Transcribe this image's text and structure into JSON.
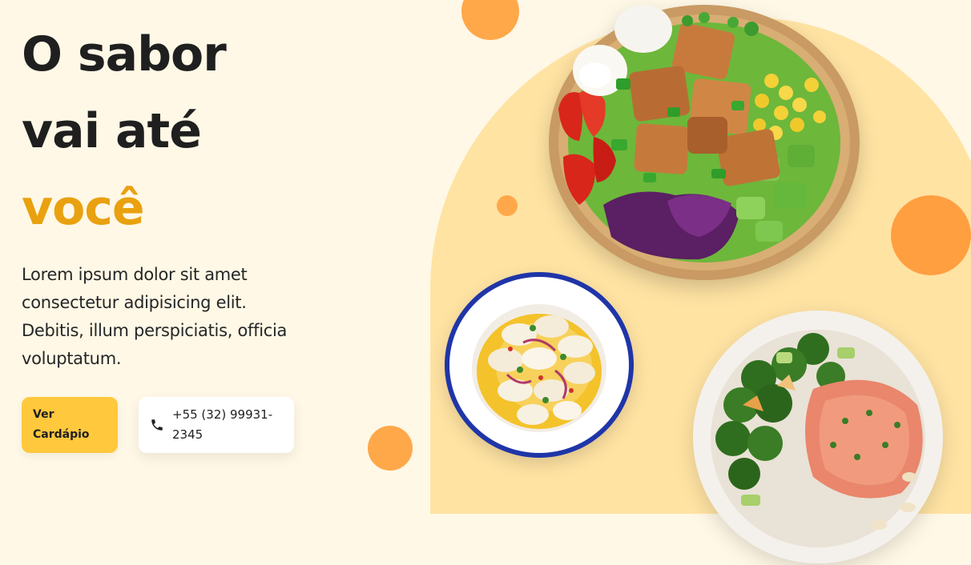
{
  "hero": {
    "title_line1": "O sabor",
    "title_line2": "vai até",
    "title_accent": "você",
    "description": "Lorem ipsum dolor sit amet consectetur adipisicing elit. Debitis, illum perspiciatis, officia voluptatum."
  },
  "actions": {
    "menu_button_label": "Ver Cardápio",
    "phone_number": "+55 (32) 99931-2345"
  },
  "icons": {
    "phone": "phone-icon"
  },
  "colors": {
    "page_background": "#fff8e6",
    "title_text": "#1f1f1f",
    "accent_text": "#e9a10f",
    "menu_button": "#ffc83d",
    "arch_background": "#ffe3a3",
    "decor_circles": "#ffa84a"
  }
}
